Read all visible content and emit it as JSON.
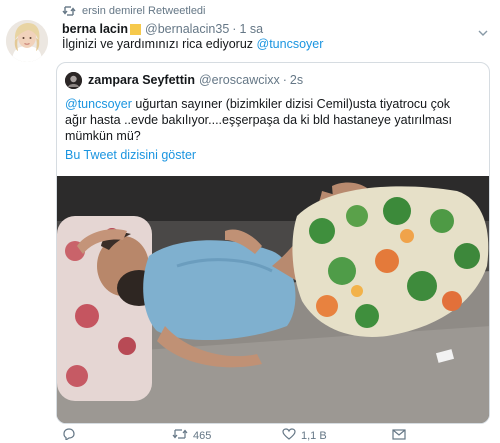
{
  "retweet": {
    "icon": "retweet-icon",
    "text": "ersin demirel Retweetledi"
  },
  "tweet": {
    "author_name": "berna lacin",
    "author_emoji": "yellow-square-emoji",
    "author_handle": "@bernalacin35",
    "separator": "·",
    "time": "1 sa",
    "text_plain": "İlginizi ve yardımınızı rica ediyoruz ",
    "text_mention": "@tuncsoyer",
    "avatar_icon": "avatar-photo"
  },
  "quote": {
    "author_name": "zampara Seyfettin",
    "author_handle": "@eroscawcixx",
    "separator": "·",
    "time": "2s",
    "line1_mention": "@tuncsoyer",
    "line1_rest": " uğurtan sayıner (bizimkiler dizisi Cemil)usta tiyatrocu çok",
    "line2": "ağır hasta ..evde bakılıyor....eşşerpaşa da ki bld hastaneye yatırılması",
    "line3": "mümkün mü?",
    "show_thread": "Bu Tweet dizisini göster",
    "photo_icon": "attached-photo"
  },
  "actions": {
    "reply_icon": "reply-icon",
    "retweet_icon": "retweet-icon",
    "retweet_count": "465",
    "like_icon": "heart-icon",
    "like_count": "1,1 B",
    "dm_icon": "mail-icon"
  },
  "colors": {
    "link": "#1b95e0",
    "muted": "#657786",
    "text": "#14171a",
    "border": "#d6dce1"
  }
}
